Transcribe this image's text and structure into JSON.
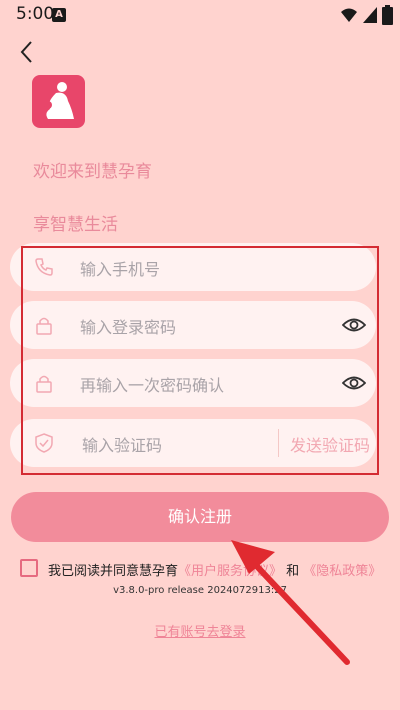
{
  "status": {
    "time": "5:00",
    "notif_badge": "A"
  },
  "header": {
    "welcome": "欢迎来到慧孕育",
    "slogan": "享智慧生活"
  },
  "form": {
    "phone_placeholder": "输入手机号",
    "password_placeholder": "输入登录密码",
    "confirm_placeholder": "再输入一次密码确认",
    "code_placeholder": "输入验证码",
    "send_code_label": "发送验证码"
  },
  "register_button": "确认注册",
  "agreement": {
    "prefix": "我已阅读并同意慧孕育",
    "user_agreement": "《用户服务协议》",
    "and": " 和 ",
    "privacy_policy": "《隐私政策》"
  },
  "version": "v3.8.0-pro release 2024072913:27",
  "login_link": "已有账号去登录",
  "colors": {
    "background": "#ffd3cf",
    "accent": "#f28c9b",
    "link": "#ef8497",
    "annotation": "#d42b33"
  },
  "icons": [
    "signal-icon",
    "wifi-icon",
    "battery-icon",
    "back-arrow-icon",
    "phone-icon",
    "lock-icon",
    "eye-icon",
    "shield-icon"
  ]
}
